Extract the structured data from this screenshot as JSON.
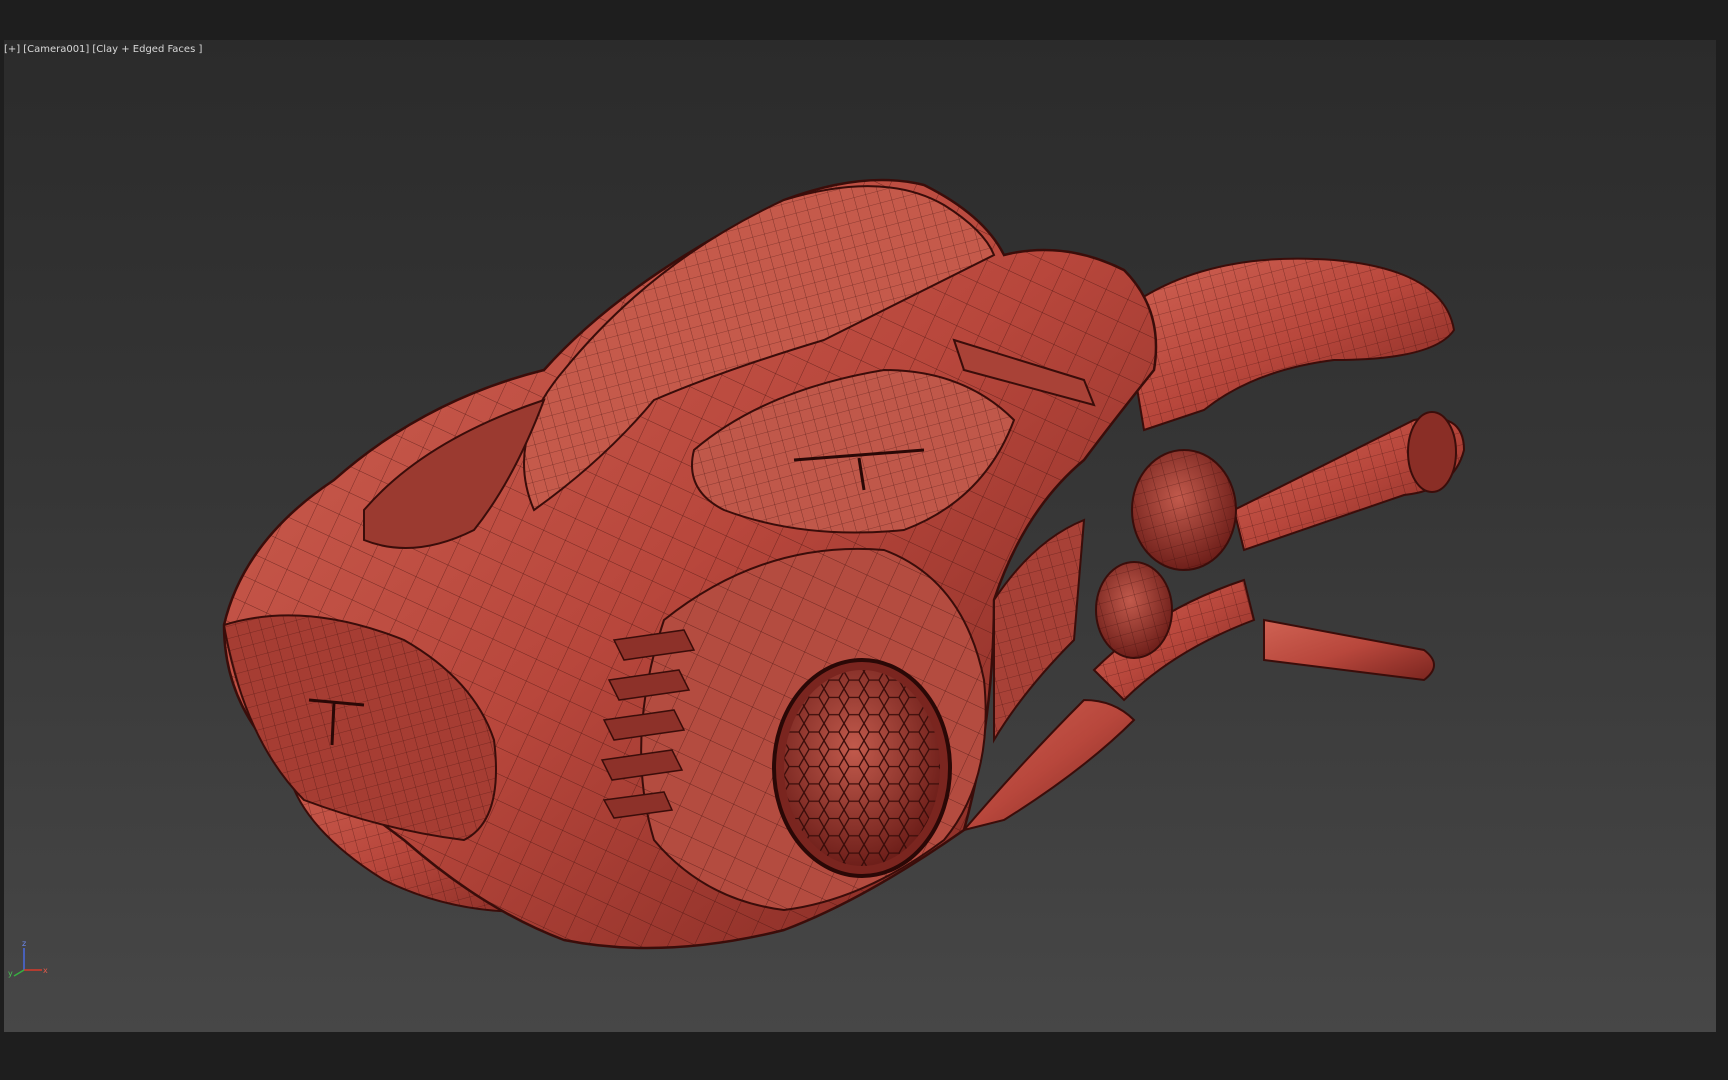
{
  "viewport": {
    "label_menu": "[+]",
    "label_camera": "[Camera001]",
    "label_shading": "[Clay + Edged Faces ]"
  },
  "gizmo": {
    "axis_z": "z",
    "axis_x": "x",
    "axis_y": "y"
  },
  "colors": {
    "background": "#1e1e1e",
    "viewport_top": "#2b2b2b",
    "viewport_bottom": "#474747",
    "clay": "#b8473c",
    "clay_light": "#cf6253",
    "clay_dark": "#6e1f1a",
    "wire": "#3a0d0a",
    "axis_x": "#d83a2a",
    "axis_y": "#36b040",
    "axis_z": "#4a6ae0"
  },
  "icons": {
    "viewport_menu": "plus-bracket-icon",
    "axis_gizmo": "axis-tripod-icon"
  }
}
